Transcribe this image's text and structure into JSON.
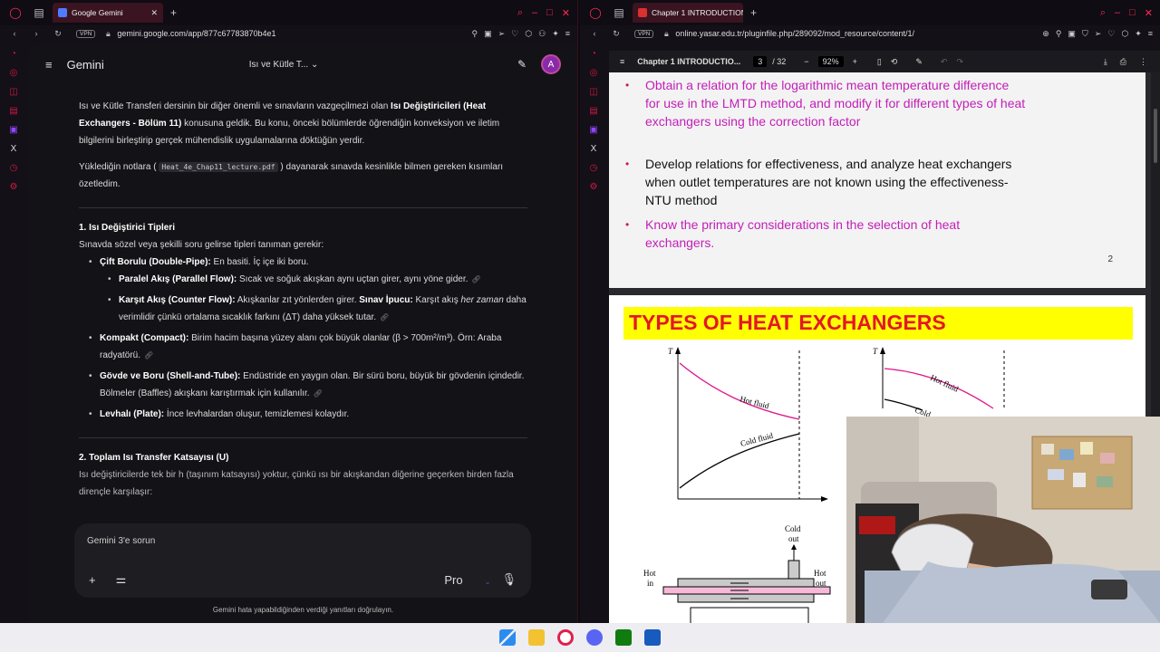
{
  "left": {
    "tab_title": "Google Gemini",
    "url": "gemini.google.com/app/877c67783870b4e1",
    "vpn": "VPN",
    "app_name": "Gemini",
    "model_title": "Isı ve Kütle T...",
    "avatar": "A",
    "chat": {
      "intro_a": "Isı ve Kütle Transferi dersinin bir diğer önemli ve sınavların vazgeçilmezi olan ",
      "intro_b": "Isı Değiştiricileri (Heat Exchangers - Bölüm 11)",
      "intro_c": " konusuna geldik. Bu konu, önceki bölümlerde öğrendiğin konveksiyon ve iletim bilgilerini birleştirip gerçek mühendislik uygulamalarına döktüğün yerdir.",
      "notes_a": "Yüklediğin notlara (",
      "notes_file": "Heat_4e_Chap11_lecture.pdf",
      "notes_b": ") dayanarak sınavda kesinlikle bilmen gereken kısımları özetledim.",
      "h1": "1. Isı Değiştirici Tipleri",
      "h1_sub": "Sınavda sözel veya şekilli soru gelirse tipleri tanıman gerekir:",
      "items": [
        {
          "b": "Çift Borulu (Double-Pipe):",
          "t": " En basiti. İç içe iki boru."
        },
        {
          "b": "Kompakt (Compact):",
          "t": " Birim hacim başına yüzey alanı çok büyük olanlar (β > 700m²/m³). Örn: Araba radyatörü."
        },
        {
          "b": "Gövde ve Boru (Shell-and-Tube):",
          "t": " Endüstride en yaygın olan. Bir sürü boru, büyük bir gövdenin içindedir. Bölmeler (Baffles) akışkanı karıştırmak için kullanılır."
        },
        {
          "b": "Levhalı (Plate):",
          "t": " İnce levhalardan oluşur, temizlemesi kolaydır."
        }
      ],
      "sub1_b": "Paralel Akış (Parallel Flow):",
      "sub1_t": " Sıcak ve soğuk akışkan aynı uçtan girer, aynı yöne gider.",
      "sub2_b": "Karşıt Akış (Counter Flow):",
      "sub2_t": " Akışkanlar zıt yönlerden girer. ",
      "sub2_b2": "Sınav İpucu:",
      "sub2_t2": " Karşıt akış ",
      "sub2_i": "her zaman",
      "sub2_t3": " daha verimlidir çünkü ortalama sıcaklık farkını (ΔT) daha yüksek tutar.",
      "h2": "2. Toplam Isı Transfer Katsayısı (U)",
      "h2_sub": "Isı değiştiricilerde tek bir h (taşınım katsayısı) yoktur, çünkü ısı bir akışkandan diğerine geçerken birden fazla dirençle karşılaşır:"
    },
    "input_placeholder": "Gemini 3'e sorun",
    "mode": "Pro",
    "footer": "Gemini hata yapabildiğinden verdiği yanıtları doğrulayın."
  },
  "right": {
    "tab_title": "Chapter 1 INTRODUCTION",
    "url": "online.yasar.edu.tr/pluginfile.php/289092/mod_resource/content/1/",
    "vpn": "VPN",
    "pdf_title": "Chapter 1 INTRODUCTIO...",
    "page": "3",
    "page_total": "/ 32",
    "zoom": "92%",
    "bullets": [
      {
        "text": "Obtain a relation for the logarithmic mean temperature difference for use in the LMTD method, and modify it for different types of heat exchangers using the correction factor",
        "color": "magenta"
      },
      {
        "text": "Develop relations for effectiveness, and analyze heat exchangers when outlet temperatures are not known using the effectiveness-NTU method",
        "color": "black"
      },
      {
        "text": "Know the primary considerations in the selection of heat exchangers.",
        "color": "magenta"
      }
    ],
    "page_number": "2",
    "banner": "TYPES OF HEAT EXCHANGERS",
    "fig": {
      "t": "T",
      "hot_fluid": "Hot fluid",
      "cold_fluid": "Cold fluid",
      "cold_out_1": "Cold",
      "cold_out_2": "out",
      "hot_in_1": "Hot",
      "hot_in_2": "in",
      "hot_out_1": "Hot",
      "hot_out_2": "out",
      "cold_partial": "Cold"
    }
  },
  "colors": {
    "accent": "#ff2a55",
    "magenta_text": "#c21fb8",
    "banner_bg": "#ffff00",
    "banner_text": "#e3172a"
  }
}
